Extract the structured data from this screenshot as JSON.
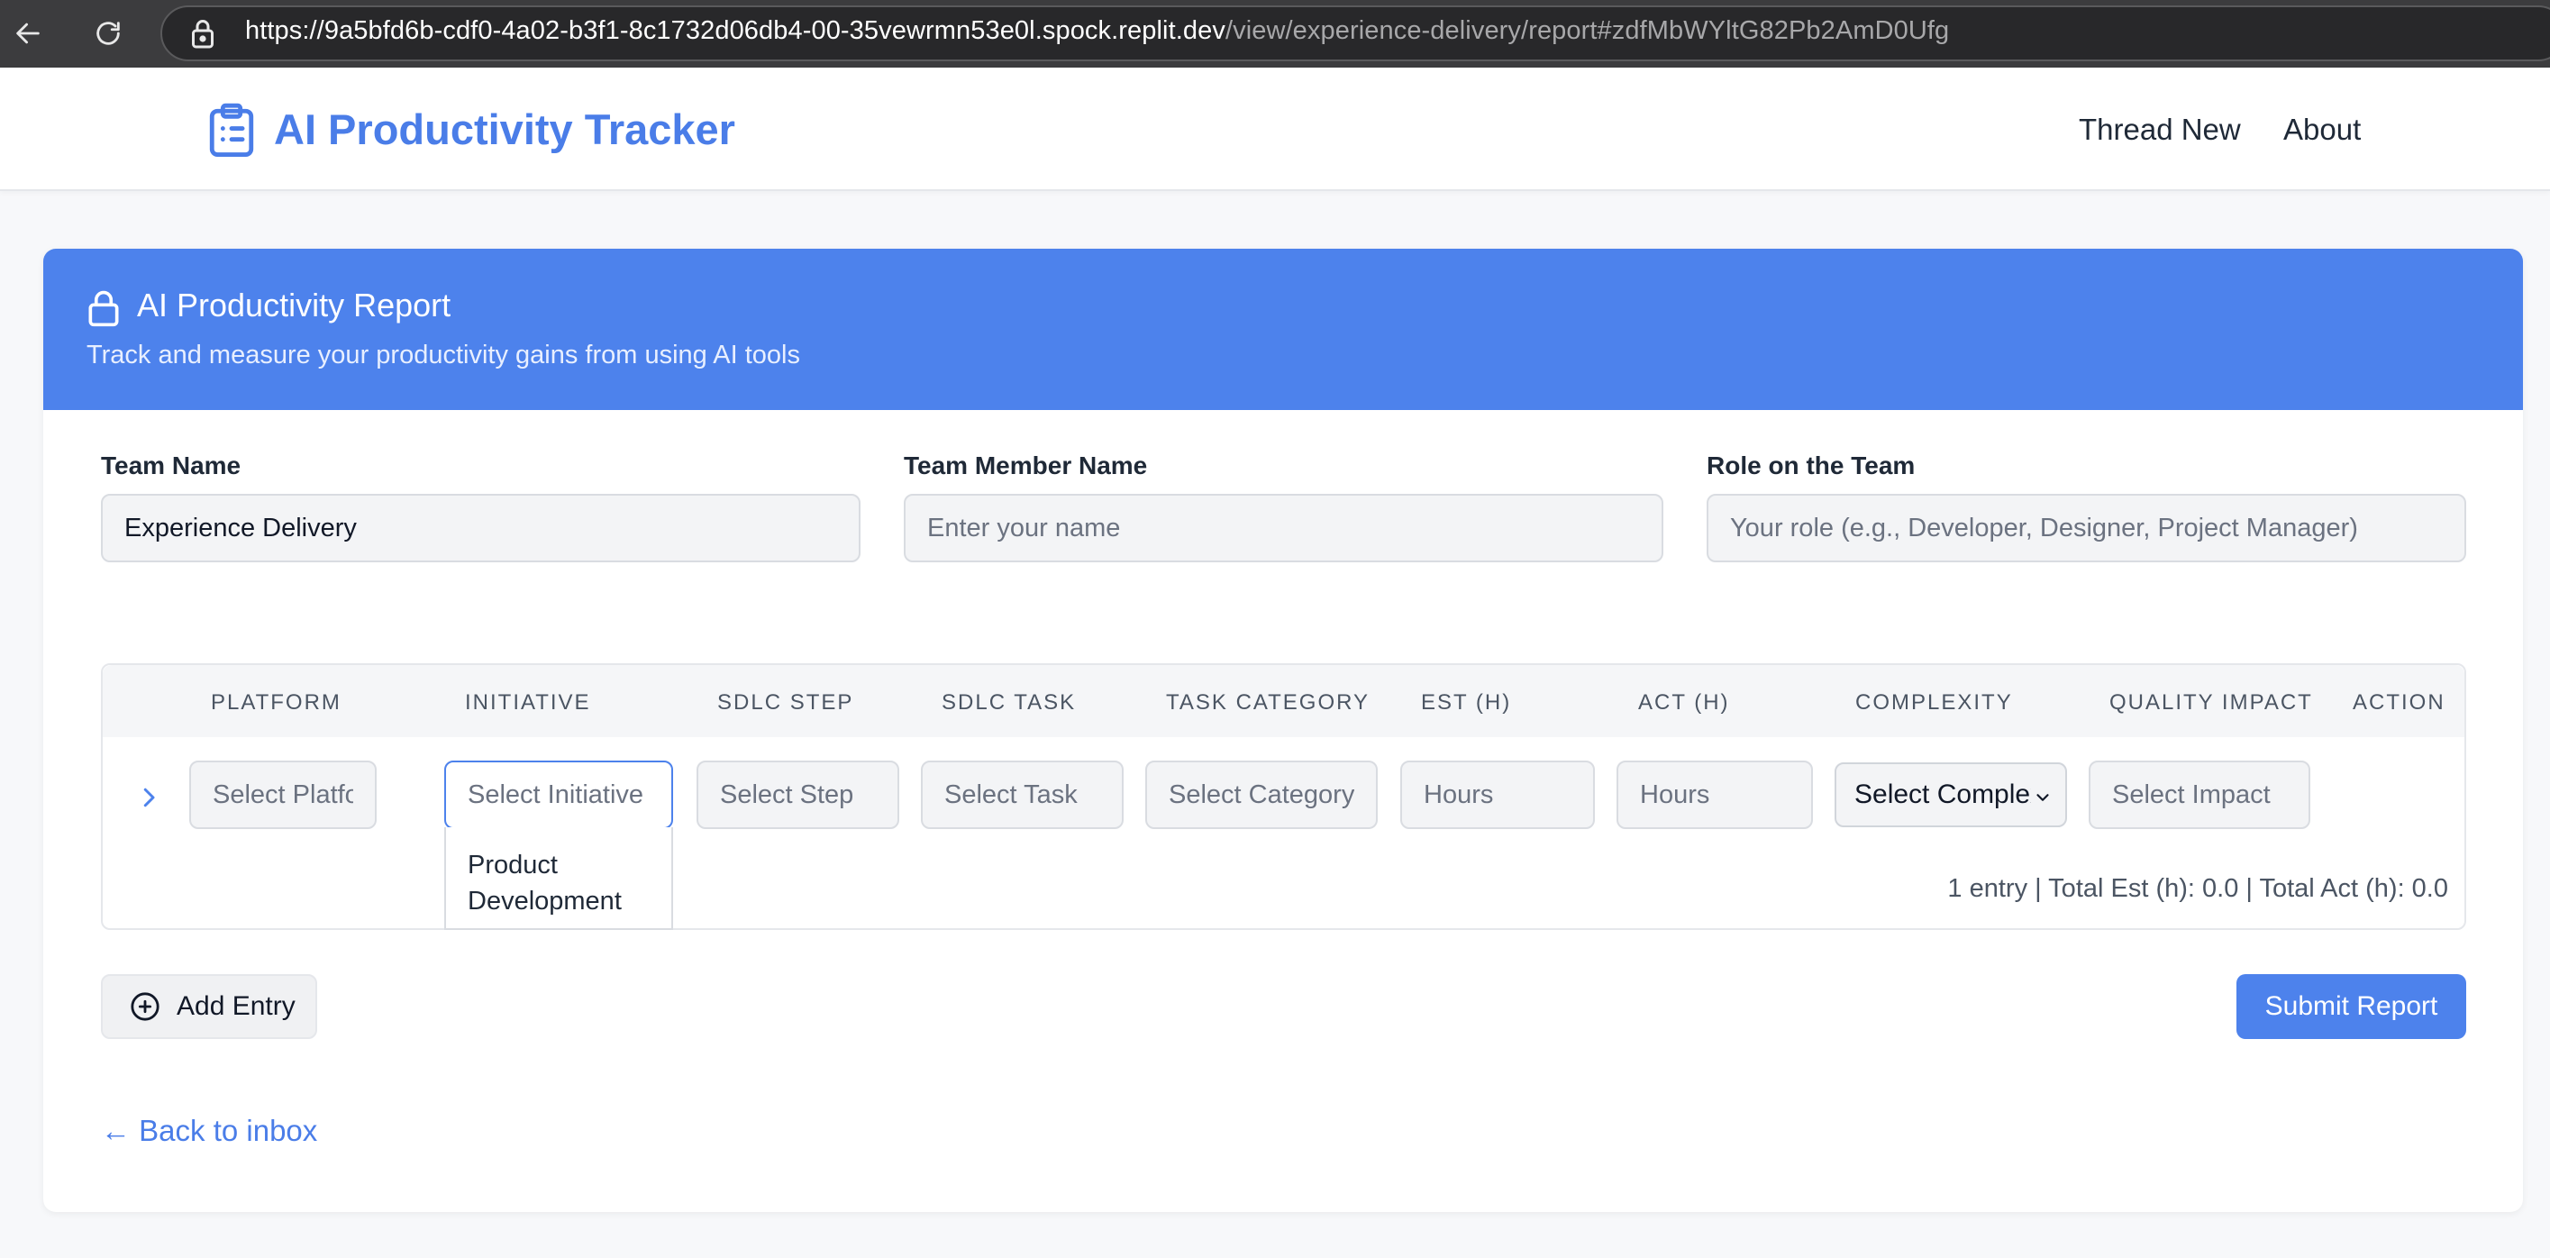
{
  "browser": {
    "url_host": "https://9a5bfd6b-cdf0-4a02-b3f1-8c1732d06db4-00-35vewrmn53e0l.spock.replit.dev",
    "url_path": "/view/experience-delivery/report#zdfMbWYltG82Pb2AmD0Ufg",
    "back_icon": "back-arrow-icon",
    "reload_icon": "reload-icon"
  },
  "header": {
    "title": "AI Productivity Tracker",
    "nav": [
      "Thread New",
      "About"
    ]
  },
  "report": {
    "title": "AI Productivity Report",
    "subtitle": "Track and measure your productivity gains from using AI tools",
    "fields": {
      "team_name": {
        "label": "Team Name",
        "value": "Experience Delivery"
      },
      "member_name": {
        "label": "Team Member Name",
        "placeholder": "Enter your name"
      },
      "role": {
        "label": "Role on the Team",
        "placeholder": "Your role (e.g., Developer, Designer, Project Manager)"
      }
    },
    "table": {
      "columns": [
        "PLATFORM",
        "INITIATIVE",
        "SDLC STEP",
        "SDLC TASK",
        "TASK CATEGORY",
        "EST (H)",
        "ACT (H)",
        "COMPLEXITY",
        "QUALITY IMPACT",
        "ACTION"
      ],
      "row": {
        "platform_placeholder": "Select Platform",
        "initiative_placeholder": "Select Initiative",
        "step_placeholder": "Select Step",
        "task_placeholder": "Select Task",
        "category_placeholder": "Select Category",
        "est_placeholder": "Hours",
        "act_placeholder": "Hours",
        "complexity_value": "Select Complexity",
        "impact_placeholder": "Select Impact"
      },
      "dropdown_option": "Product Development",
      "summary": "1 entry | Total Est (h): 0.0 | Total Act (h): 0.0"
    },
    "actions": {
      "add_entry": "Add Entry",
      "submit": "Submit Report",
      "back": "← Back to inbox"
    }
  },
  "colors": {
    "accent": "#4d82ec",
    "brand_text": "#4a7de8"
  }
}
